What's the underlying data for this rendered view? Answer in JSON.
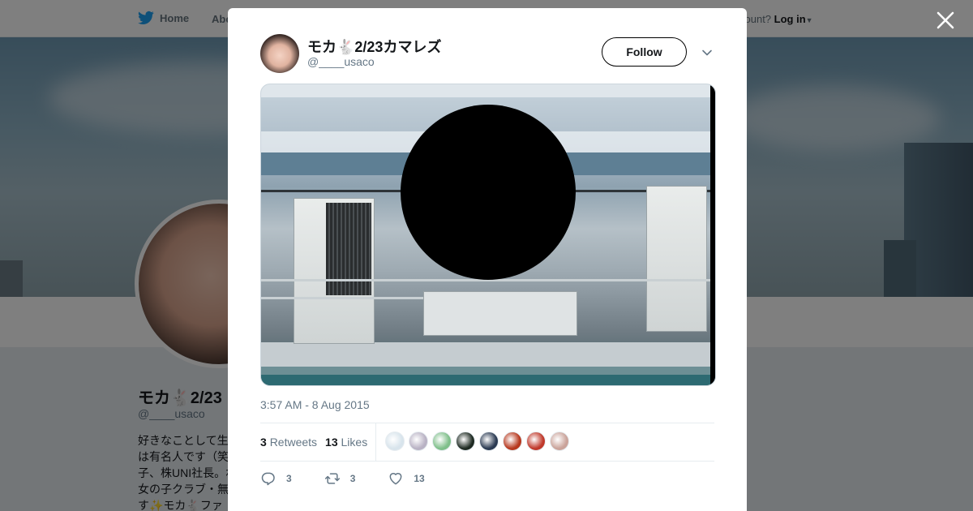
{
  "header": {
    "home_label": "Home",
    "about_label": "Abo",
    "login_prompt": "count?",
    "login_label": "Log in"
  },
  "profile": {
    "name": "モカ🐇2/23",
    "handle": "@____usaco",
    "bio_lines": [
      "好きなことして生",
      "は有名人です（笑",
      "子、株UNI社長。ね",
      "女の子クラブ・無",
      "す✨モカ🐇ファ"
    ]
  },
  "tweet": {
    "display_name": "モカ🐇2/23カマレズ",
    "handle": "@____usaco",
    "follow_label": "Follow",
    "timestamp": "3:57 AM - 8 Aug 2015",
    "retweets_count": "3",
    "retweets_label": "Retweets",
    "likes_count": "13",
    "likes_label": "Likes",
    "reply_count": "3",
    "retweet_count": "3",
    "like_count": "13"
  },
  "likers": [
    "#d8e4ec",
    "#b9b2c4",
    "#7fbf8a",
    "#1e2a22",
    "#2b3a52",
    "#b7381e",
    "#c0392b",
    "#caa39a"
  ],
  "colors": {
    "accent": "#1da1f2",
    "text_primary": "#14171a",
    "text_secondary": "#657786"
  },
  "icons": {
    "bird": "twitter-bird-icon",
    "close": "close-icon",
    "chevron": "chevron-down-icon",
    "reply": "reply-icon",
    "retweet": "retweet-icon",
    "like": "heart-icon"
  }
}
